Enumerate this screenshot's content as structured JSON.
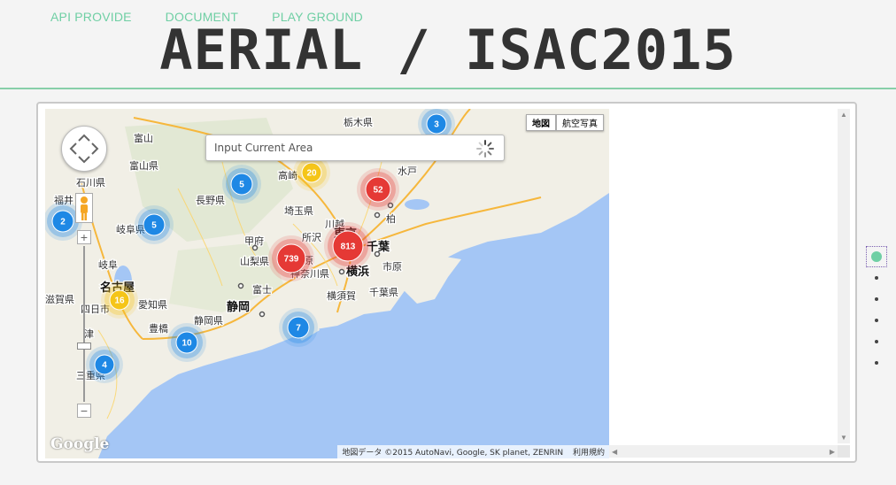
{
  "nav": [
    {
      "label": "API PROVIDE"
    },
    {
      "label": "DOCUMENT"
    },
    {
      "label": "PLAY GROUND"
    }
  ],
  "title": "AERIAL / ISAC2015",
  "map": {
    "search_placeholder": "Input Current Area",
    "map_types": [
      {
        "label": "地図",
        "active": true
      },
      {
        "label": "航空写真",
        "active": false
      }
    ],
    "attribution": "地図データ ©2015 AutoNavi, Google, SK planet, ZENRIN",
    "terms": "利用規約",
    "logo": "Google",
    "zoom_in": "+",
    "zoom_out": "−",
    "clusters": [
      {
        "count": "3",
        "color": "blue"
      },
      {
        "count": "20",
        "color": "yellow"
      },
      {
        "count": "52",
        "color": "red"
      },
      {
        "count": "5",
        "color": "blue"
      },
      {
        "count": "2",
        "color": "blue"
      },
      {
        "count": "5",
        "color": "blue"
      },
      {
        "count": "813",
        "color": "red"
      },
      {
        "count": "739",
        "color": "red"
      },
      {
        "count": "16",
        "color": "yellow"
      },
      {
        "count": "7",
        "color": "blue"
      },
      {
        "count": "10",
        "color": "blue"
      },
      {
        "count": "4",
        "color": "blue"
      }
    ],
    "place_labels": [
      "栃木県",
      "富山",
      "富山県",
      "石川県",
      "福井",
      "長野県",
      "高崎",
      "水戸",
      "埼玉県",
      "川越",
      "所沢",
      "柏",
      "甲府",
      "東京",
      "千葉",
      "山梨県",
      "原",
      "横浜",
      "市原",
      "岐阜県",
      "岐阜",
      "神奈川県",
      "富士",
      "千葉県",
      "名古屋",
      "横須賀",
      "滋賀県",
      "愛知県",
      "静岡",
      "四日市",
      "静岡県",
      "豊橋",
      "津",
      "三重県"
    ]
  },
  "colors": {
    "accent": "#6fcfa4",
    "cluster_blue": "#1e88e5",
    "cluster_yellow": "#f5c518",
    "cluster_red": "#e53935"
  },
  "side_dots": [
    {
      "active": true
    },
    {
      "active": false
    },
    {
      "active": false
    },
    {
      "active": false
    },
    {
      "active": false
    },
    {
      "active": false
    }
  ]
}
